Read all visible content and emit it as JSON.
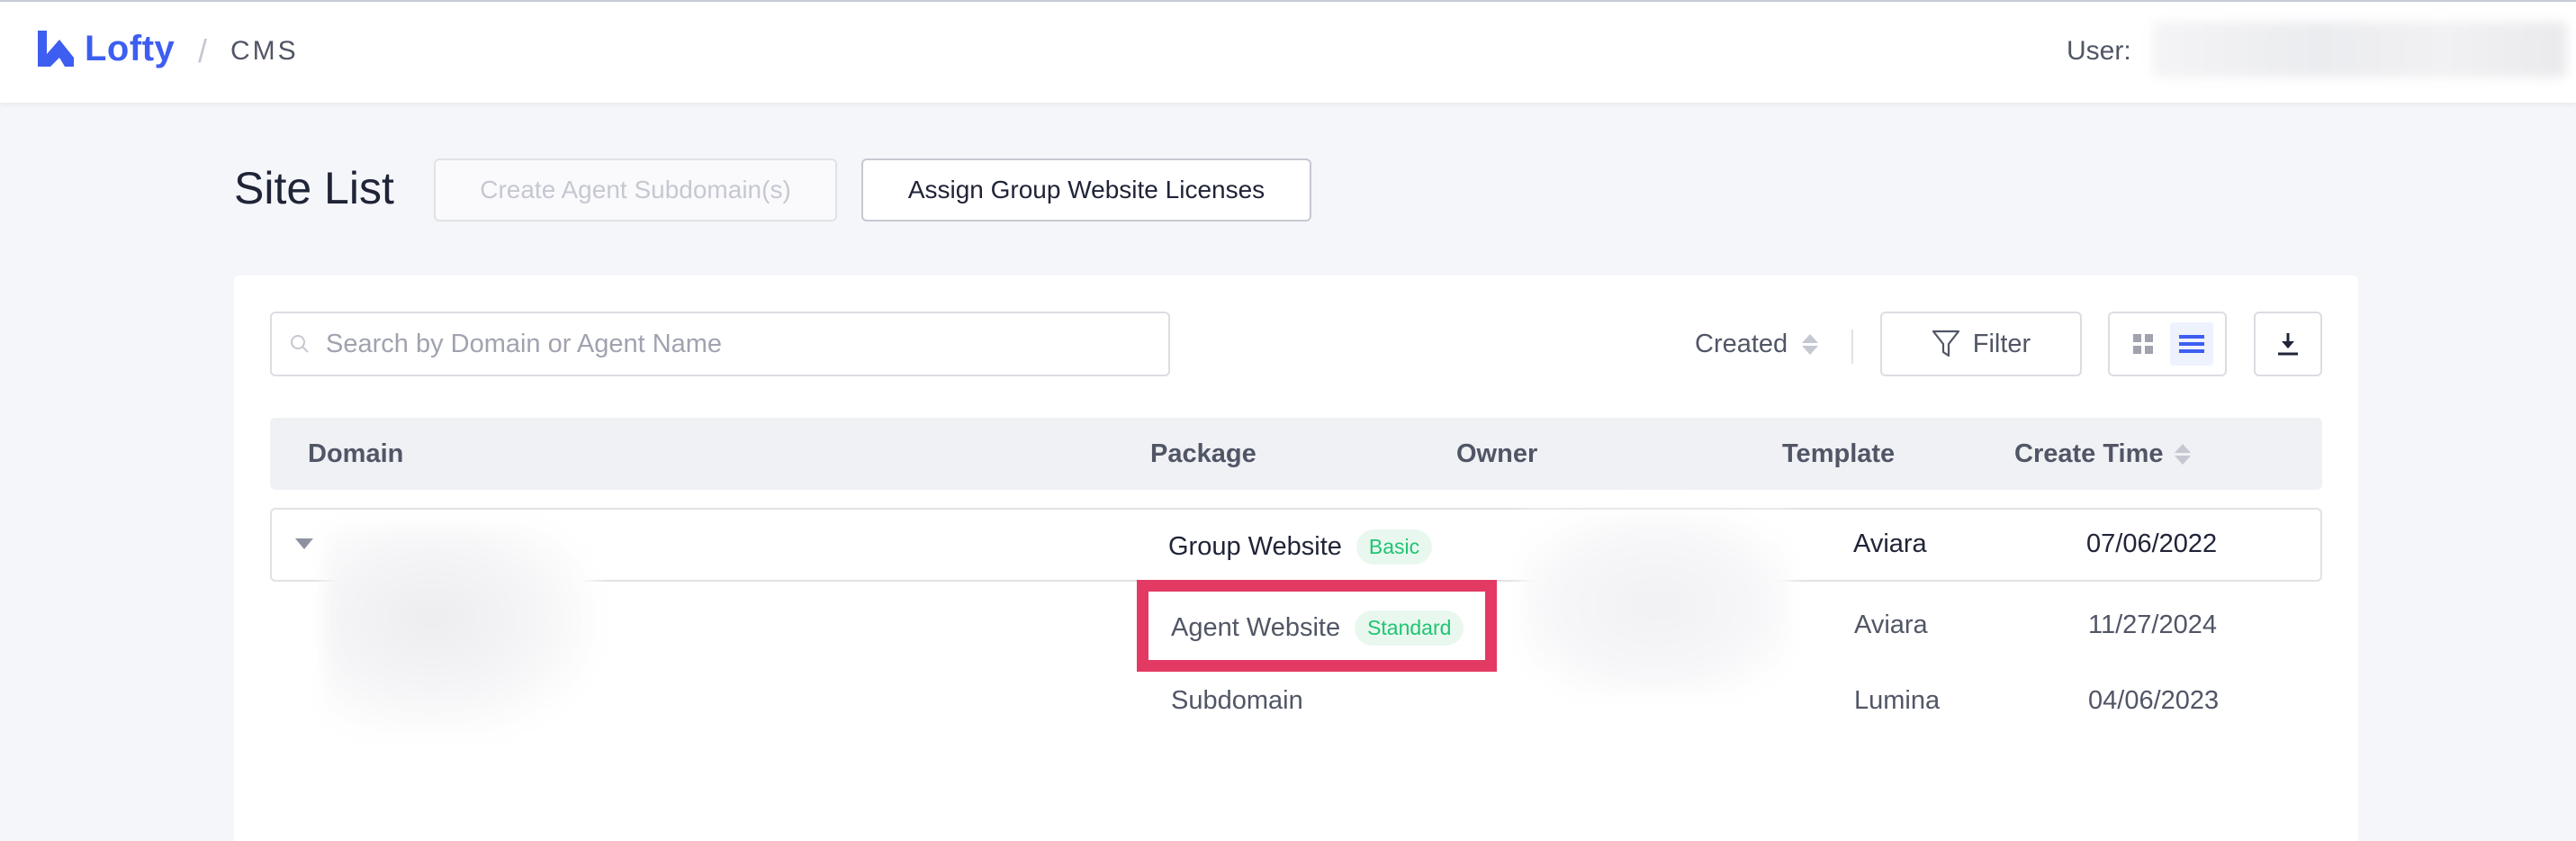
{
  "header": {
    "brand": "Lofty",
    "separator": "/",
    "section": "CMS",
    "user_label": "User:"
  },
  "page": {
    "title": "Site List",
    "create_subdomain_label": "Create Agent Subdomain(s)",
    "assign_licenses_label": "Assign Group Website Licenses"
  },
  "toolbar": {
    "search_placeholder": "Search by Domain or Agent Name",
    "sort_label": "Created",
    "filter_label": "Filter",
    "view_mode": "list"
  },
  "table": {
    "columns": [
      "Domain",
      "Package",
      "Owner",
      "Template",
      "Create Time"
    ],
    "parent_row": {
      "package": "Group Website",
      "badge": "Basic",
      "template": "Aviara",
      "create_time": "07/06/2022"
    },
    "child_rows": [
      {
        "package": "Agent Website",
        "badge": "Standard",
        "template": "Aviara",
        "create_time": "11/27/2024"
      },
      {
        "package": "Subdomain",
        "badge": "",
        "template": "Lumina",
        "create_time": "04/06/2023"
      }
    ]
  },
  "colors": {
    "brand": "#3d5ef0",
    "badge_text": "#20c472",
    "badge_bg": "#e9f8ef",
    "highlight": "#e33a64"
  }
}
